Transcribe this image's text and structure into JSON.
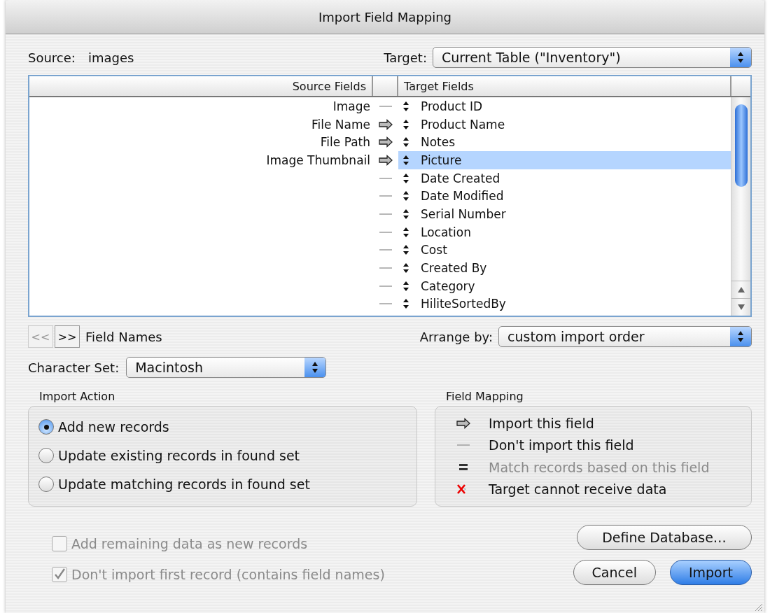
{
  "window": {
    "title": "Import Field Mapping"
  },
  "source": {
    "label": "Source:",
    "value": "images"
  },
  "target": {
    "label": "Target:",
    "value": "Current Table (\"Inventory\")"
  },
  "mapping_table": {
    "columns": [
      "Source Fields",
      "Target Fields"
    ],
    "rows": [
      {
        "source": "Image",
        "kind": "none",
        "target": "Product ID",
        "selected": false
      },
      {
        "source": "File Name",
        "kind": "import",
        "target": "Product Name",
        "selected": false
      },
      {
        "source": "File Path",
        "kind": "import",
        "target": "Notes",
        "selected": false
      },
      {
        "source": "Image Thumbnail",
        "kind": "import",
        "target": "Picture",
        "selected": true
      },
      {
        "kind": "none",
        "target": "Date Created",
        "selected": false
      },
      {
        "kind": "none",
        "target": "Date Modified",
        "selected": false
      },
      {
        "kind": "none",
        "target": "Serial Number",
        "selected": false
      },
      {
        "kind": "none",
        "target": "Location",
        "selected": false
      },
      {
        "kind": "none",
        "target": "Cost",
        "selected": false
      },
      {
        "kind": "none",
        "target": "Created By",
        "selected": false
      },
      {
        "kind": "none",
        "target": "Category",
        "selected": false
      },
      {
        "kind": "none",
        "target": "HiliteSortedBy",
        "selected": false
      }
    ]
  },
  "field_names_nav": {
    "buttons": [
      {
        "label": "<<",
        "disabled": true
      },
      {
        "label": ">>",
        "disabled": false
      }
    ],
    "label": "Field Names"
  },
  "arrange_by": {
    "label": "Arrange by:",
    "value": "custom import order"
  },
  "character_set": {
    "label": "Character Set:",
    "value": "Macintosh"
  },
  "import_action": {
    "title": "Import Action",
    "options": [
      {
        "label": "Add new records",
        "selected": true
      },
      {
        "label": "Update existing records in found set",
        "selected": false
      },
      {
        "label": "Update matching records in found set",
        "selected": false
      }
    ]
  },
  "field_mapping_legend": {
    "title": "Field Mapping",
    "items": [
      {
        "kind": "import",
        "label": "Import this field",
        "disabled": false
      },
      {
        "kind": "none",
        "label": "Don't import this field",
        "disabled": false
      },
      {
        "kind": "match",
        "label": "Match records based on this field",
        "disabled": true
      },
      {
        "kind": "cannot",
        "label": "Target cannot receive data",
        "disabled": false
      }
    ]
  },
  "checkboxes": [
    {
      "label": "Add remaining data as new records",
      "checked": false,
      "disabled": true
    },
    {
      "label": "Don't import first record (contains field names)",
      "checked": true,
      "disabled": true
    }
  ],
  "buttons": [
    {
      "label": "Define Database…",
      "default": false
    },
    {
      "label": "Cancel",
      "default": false
    },
    {
      "label": "Import",
      "default": true
    }
  ]
}
